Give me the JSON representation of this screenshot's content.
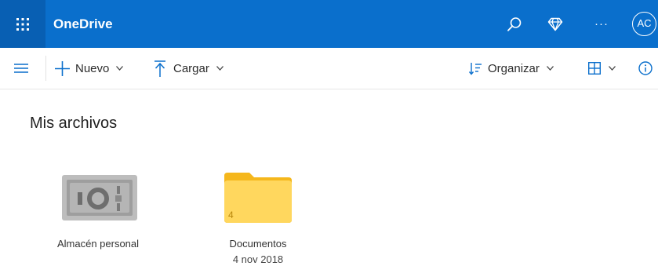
{
  "header": {
    "app_title": "OneDrive",
    "waffle_icon": "app-launcher-icon",
    "search_icon": "search-icon",
    "premium_icon": "diamond-icon",
    "more_label": "···",
    "avatar_initials": "AC",
    "bar_color": "#0a6fcc"
  },
  "commands": {
    "menu_icon": "hamburger-menu-icon",
    "new_label": "Nuevo",
    "upload_label": "Cargar",
    "sort_label": "Organizar",
    "view_icon": "grid-view-icon",
    "info_icon": "info-icon",
    "accent_color": "#0a6fcc"
  },
  "main": {
    "title": "Mis archivos",
    "items": [
      {
        "name": "Almacén personal",
        "date": "",
        "icon": "vault-icon"
      },
      {
        "name": "Documentos",
        "date": "4 nov 2018",
        "count": "4",
        "icon": "folder-icon"
      }
    ]
  }
}
